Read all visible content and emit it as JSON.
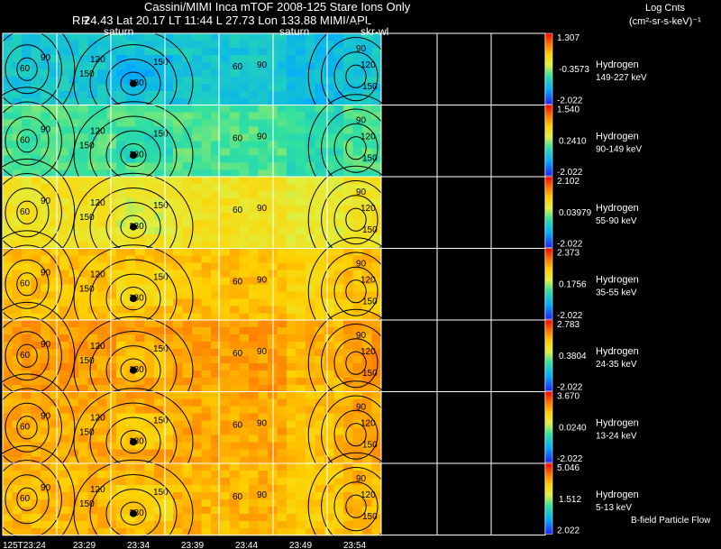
{
  "header": {
    "title": "Cassini/MIMI Inca mTOF  2008-125   Stare   Ions Only",
    "info": "R      24.43 Lat 20.17 LT 11:44 L      27.73 Lon      133.88  MIMI/APL",
    "colorbar_title": "Log Cnts",
    "colorbar_unit": "(cm²-sr-s-keV)⁻¹"
  },
  "chart_data": {
    "type": "heatmap",
    "time_axis": {
      "ticks": [
        "125T23:24",
        "23:29",
        "23:34",
        "23:39",
        "23:44",
        "23:49",
        "23:54"
      ]
    },
    "markers": [
      "saturn",
      "saturn",
      "skr-wl"
    ],
    "marker_first_label": "R",
    "panels": [
      {
        "species": "Hydrogen",
        "energy": "149-227 keV",
        "max": "1.307",
        "mid": "-0.3573",
        "min": "-2.022",
        "level": 0.3
      },
      {
        "species": "Hydrogen",
        "energy": "90-149 keV",
        "max": "1.540",
        "mid": "0.2410",
        "min": "-2.022",
        "level": 0.42
      },
      {
        "species": "Hydrogen",
        "energy": "55-90 keV",
        "max": "2.102",
        "mid": "0.03979",
        "min": "-2.022",
        "level": 0.62
      },
      {
        "species": "Hydrogen",
        "energy": "35-55 keV",
        "max": "2.373",
        "mid": "0.1756",
        "min": "-2.022",
        "level": 0.72
      },
      {
        "species": "Hydrogen",
        "energy": "24-35 keV",
        "max": "2.783",
        "mid": "0.3804",
        "min": "-2.022",
        "level": 0.78
      },
      {
        "species": "Hydrogen",
        "energy": "13-24 keV",
        "max": "3.670",
        "mid": "0.0240",
        "min": "-2.022",
        "level": 0.76
      },
      {
        "species": "Hydrogen",
        "energy": "5-13 keV",
        "max": "5.046",
        "mid": "1.512",
        "min": "2.022",
        "level": 0.74
      }
    ],
    "contour_labels": [
      "60",
      "90",
      "120",
      "150",
      "180"
    ],
    "footnote": "B-field Particle Flow"
  },
  "colors": {
    "background": "#000000",
    "grid": "#ffffff",
    "contour": "#000000"
  }
}
